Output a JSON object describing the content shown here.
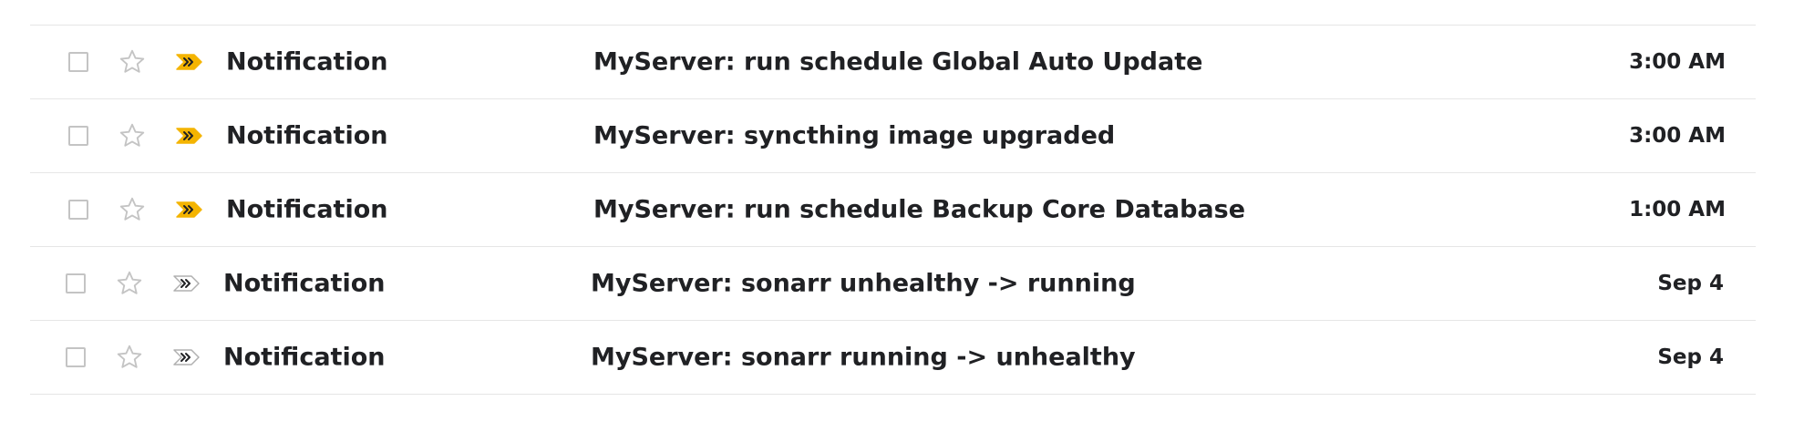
{
  "colors": {
    "importance_marked": "#f4b400",
    "importance_unmarked": "#b0b0b0",
    "star": "#c4c4c4",
    "divider": "#e6e6e6",
    "text": "#202124"
  },
  "icons": {
    "checkbox": "checkbox-icon",
    "star": "star-outline-icon",
    "importance": "importance-marker-icon"
  },
  "messages": [
    {
      "sender": "Notification",
      "subject": "MyServer: run schedule Global Auto Update",
      "date": "3:00 AM",
      "important": true
    },
    {
      "sender": "Notification",
      "subject": "MyServer: syncthing image upgraded",
      "date": "3:00 AM",
      "important": true
    },
    {
      "sender": "Notification",
      "subject": "MyServer: run schedule Backup Core Database",
      "date": "1:00 AM",
      "important": true
    },
    {
      "sender": "Notification",
      "subject": "MyServer: sonarr unhealthy -> running",
      "date": "Sep 4",
      "important": false
    },
    {
      "sender": "Notification",
      "subject": "MyServer: sonarr running -> unhealthy",
      "date": "Sep 4",
      "important": false
    }
  ]
}
